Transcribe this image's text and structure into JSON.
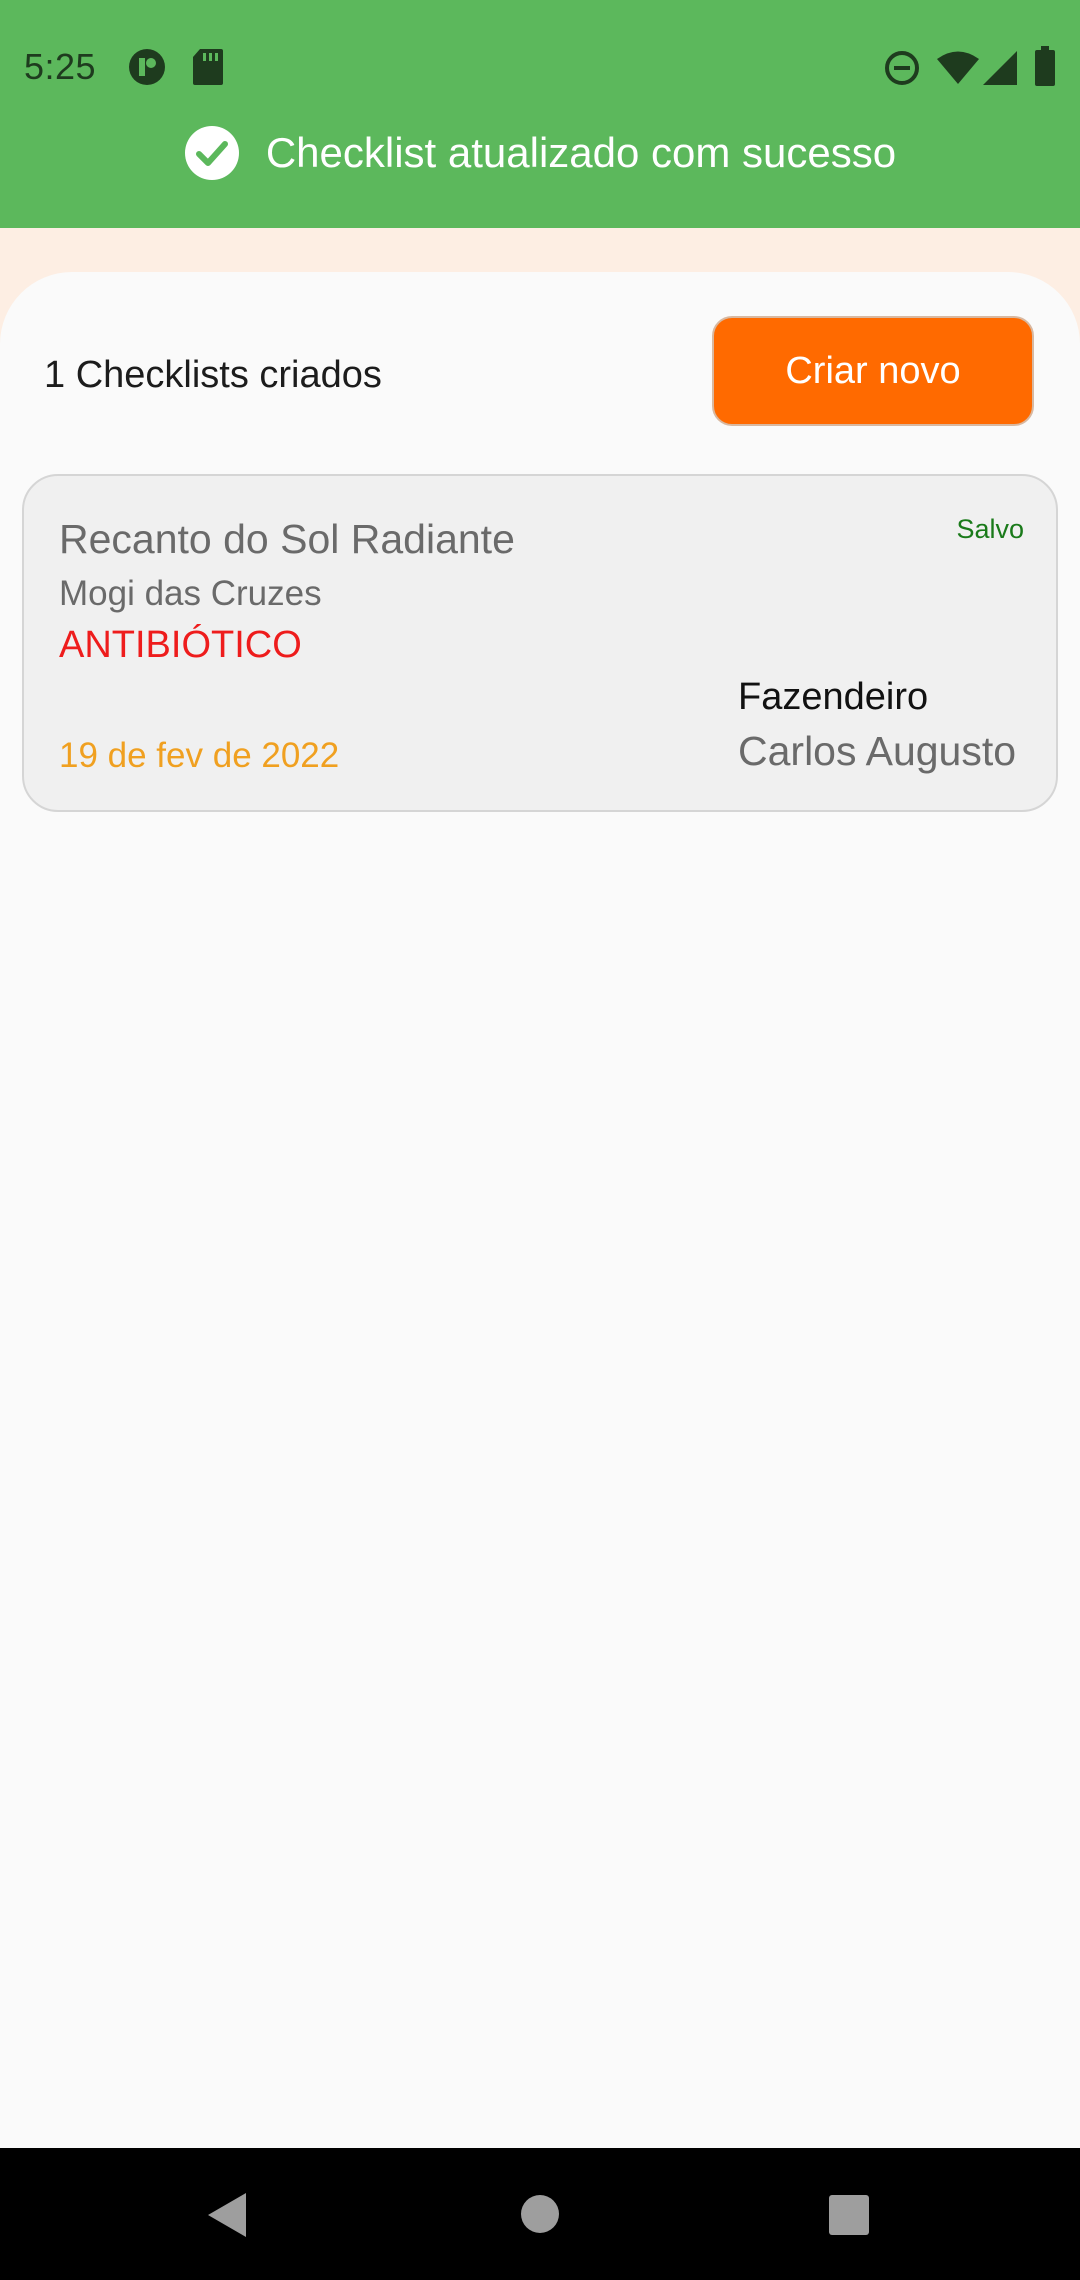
{
  "status_bar": {
    "time": "5:25",
    "left_icons": [
      "app-notification-icon",
      "sd-card-icon"
    ],
    "right_icons": [
      "do-not-disturb-icon",
      "wifi-icon",
      "cell-signal-icon",
      "battery-icon"
    ]
  },
  "toast": {
    "icon": "check-circle-icon",
    "message": "Checklist atualizado com sucesso",
    "color": "#5cb85c"
  },
  "header": {
    "count_label": "1 Checklists criados",
    "create_button_label": "Criar novo",
    "accent_color": "#ff6a00"
  },
  "checklists": [
    {
      "title": "Recanto do Sol Radiante",
      "city": "Mogi das Cruzes",
      "category": "ANTIBIÓTICO",
      "date": "19 de fev de 2022",
      "status": "Salvo",
      "role": "Fazendeiro",
      "person": "Carlos Augusto"
    }
  ],
  "nav_bar": {
    "buttons": [
      "back-icon",
      "home-icon",
      "recents-icon"
    ]
  }
}
